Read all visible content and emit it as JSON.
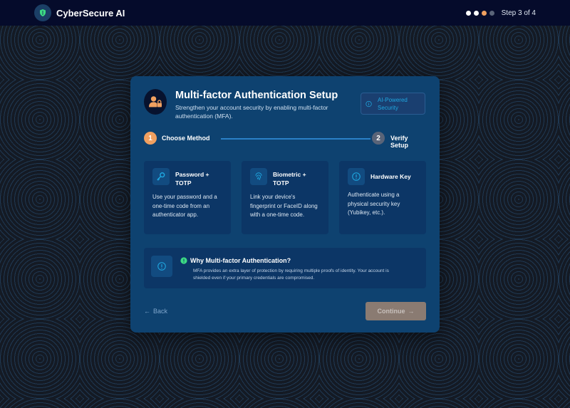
{
  "app": {
    "name": "CyberSecure AI",
    "step_indicator": "Step 3 of 4",
    "step_dots": [
      "#ffffff",
      "#ffffff",
      "#f0a060",
      "#5a6478"
    ]
  },
  "card": {
    "title": "Multi-factor Authentication Setup",
    "subtitle": "Strengthen your account security by enabling multi-factor authentication (MFA).",
    "badge": "AI-Powered Security",
    "icon": "user-lock-icon"
  },
  "progress": {
    "steps": [
      {
        "number": "1",
        "label": "Choose Method",
        "color": "#f0a060"
      },
      {
        "number": "2",
        "label": "Verify Setup",
        "color": "#5a6478"
      }
    ]
  },
  "methods": [
    {
      "icon": "key-icon",
      "title": "Password + TOTP",
      "description": "Use your password and a one-time code from an authenticator app."
    },
    {
      "icon": "fingerprint-icon",
      "title": "Biometric + TOTP",
      "description": "Link your device's fingerprint or FaceID along with a one-time code."
    },
    {
      "icon": "info-circle-icon",
      "title": "Hardware Key",
      "description": "Authenticate using a physical security key (Yubikey, etc.)."
    }
  ],
  "info": {
    "title": "Why Multi-factor Authentication?",
    "text": "MFA provides an extra layer of protection by requiring multiple proofs of identity. Your account is shielded even if your primary credentials are compromised."
  },
  "actions": {
    "back_label": "Back",
    "continue_label": "Continue"
  },
  "colors": {
    "accent": "#f0a060",
    "card": "#0e4270",
    "topbar": "#050b2b"
  }
}
